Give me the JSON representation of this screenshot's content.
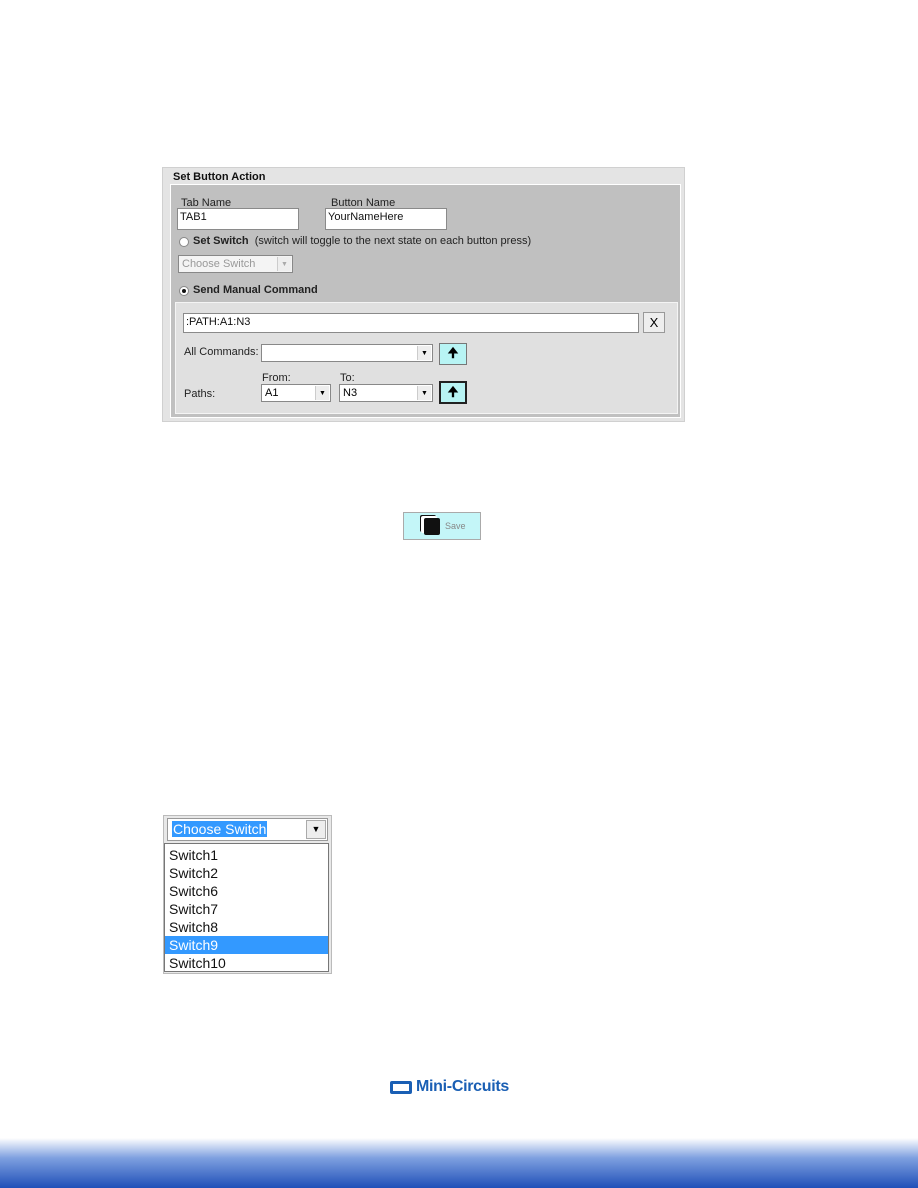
{
  "panel": {
    "title": "Set Button Action",
    "tab_name_label": "Tab Name",
    "tab_name_value": "TAB1",
    "button_name_label": "Button Name",
    "button_name_value": "YourNameHere",
    "set_switch_label": "Set Switch",
    "set_switch_note": "(switch will toggle to the next state on each button press)",
    "choose_switch_placeholder": "Choose Switch",
    "send_manual_label": "Send Manual Command",
    "command_value": ":PATH:A1:N3",
    "clear_label": "X",
    "all_commands_label": "All Commands:",
    "all_commands_value": "",
    "from_label": "From:",
    "to_label": "To:",
    "paths_label": "Paths:",
    "from_value": "A1",
    "to_value": "N3",
    "selected_mode": "Send Manual Command"
  },
  "save_button": {
    "label": "Save",
    "icon": "floppy-disk-icon"
  },
  "dropdown": {
    "selected": "Choose Switch",
    "options": [
      "Switch1",
      "Switch2",
      "Switch6",
      "Switch7",
      "Switch8",
      "Switch9",
      "Switch10"
    ],
    "highlighted": "Switch9",
    "highlight_color": "#3399ff"
  },
  "footer": {
    "logo": "Mini-Circuits",
    "logo_color": "#1a5fb4"
  }
}
